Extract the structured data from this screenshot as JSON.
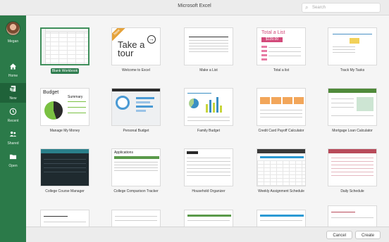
{
  "window": {
    "title": "Microsoft Excel"
  },
  "search": {
    "placeholder": "Search"
  },
  "sidebar": {
    "user": "Megan",
    "items": [
      {
        "label": "Home",
        "icon": "home-icon"
      },
      {
        "label": "New",
        "icon": "new-document-icon",
        "active": true
      },
      {
        "label": "Recent",
        "icon": "clock-icon"
      },
      {
        "label": "Shared",
        "icon": "people-icon"
      },
      {
        "label": "Open",
        "icon": "folder-icon"
      }
    ]
  },
  "templates": [
    {
      "caption": "Blank Workbook",
      "selected": true
    },
    {
      "caption": "Welcome to Excel",
      "tour_text": "Take a tour",
      "ribbon": "New"
    },
    {
      "caption": "Make a List"
    },
    {
      "caption": "Total a list",
      "title": "Total a List",
      "amount": "$139.00"
    },
    {
      "caption": "Track My Tasks"
    },
    {
      "caption": "Manage My Money",
      "title": "Budget",
      "subtitle": "Summary"
    },
    {
      "caption": "Personal Budget"
    },
    {
      "caption": "Family Budget"
    },
    {
      "caption": "Credit Card Payoff Calculator"
    },
    {
      "caption": "Mortgage Loan Calculator"
    },
    {
      "caption": "College Course Manager"
    },
    {
      "caption": "College Comparison Tracker",
      "title": "Applications"
    },
    {
      "caption": "Household Organizer"
    },
    {
      "caption": "Weekly Assignment Schedule"
    },
    {
      "caption": "Daily Schedule"
    },
    {
      "caption": ""
    },
    {
      "caption": ""
    },
    {
      "caption": ""
    },
    {
      "caption": ""
    },
    {
      "caption": ""
    }
  ],
  "footer": {
    "cancel_label": "Cancel",
    "create_label": "Create"
  },
  "colors": {
    "sidebar": "#2b7a49",
    "sidebar_active": "#1f6239",
    "accent_pink": "#d24a7a"
  }
}
